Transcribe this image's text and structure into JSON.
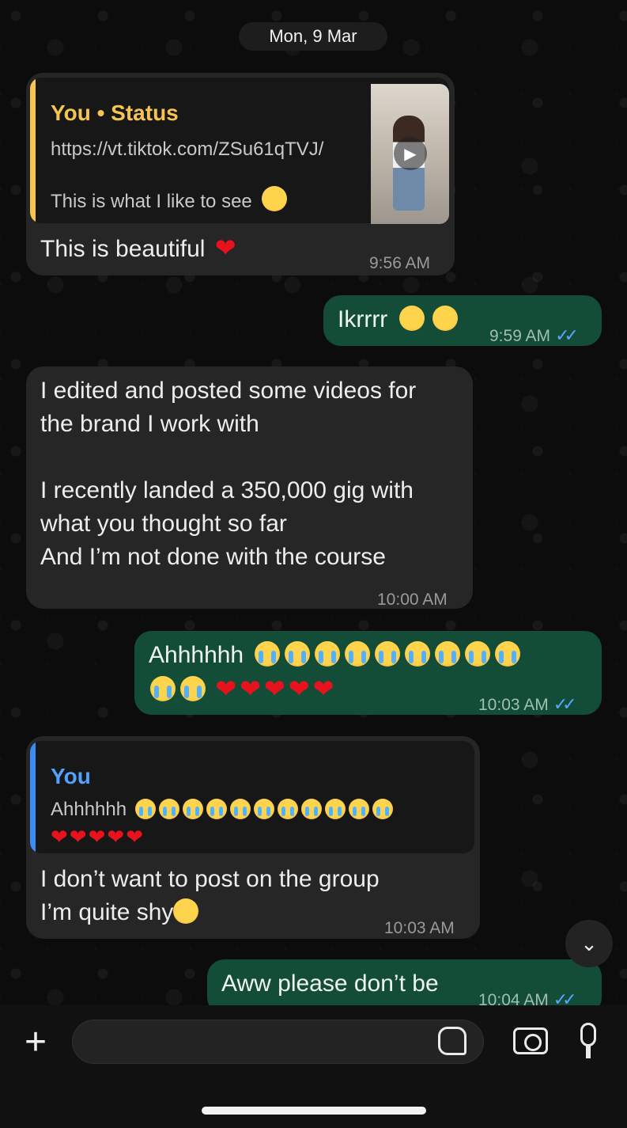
{
  "date_label": "Mon, 9 Mar",
  "messages": [
    {
      "quote_title": "You • Status",
      "quote_link": "https://vt.tiktok.com/ZSu61qTVJ/",
      "quote_caption": "This is what I like to see",
      "text": "This is beautiful",
      "time": "9:56 AM"
    },
    {
      "text": "Ikrrrr",
      "time": "9:59 AM"
    },
    {
      "line1": "I edited and posted some videos for",
      "line2": "the brand I work with",
      "line3": "I recently landed a 350,000 gig with",
      "line4": "what you thought so far",
      "line5": "And I’m not done with the course",
      "time": "10:00 AM"
    },
    {
      "text": "Ahhhhhh",
      "time": "10:03 AM"
    },
    {
      "quote_title": "You",
      "quote_text": "Ahhhhhh",
      "line1": "I don’t want to post on the group",
      "line2": "I’m quite shy",
      "time": "10:03 AM"
    },
    {
      "text": "Aww please don’t be",
      "time": "10:04 AM"
    }
  ],
  "read_ticks": "✓✓",
  "icons": {
    "scroll_down": "chevron-down-icon",
    "attach": "plus-icon",
    "sticker": "sticker-icon",
    "camera": "camera-icon",
    "mic": "microphone-icon"
  },
  "colors": {
    "outgoing_bubble": "#144d37",
    "incoming_bubble": "#262626",
    "status_quote_bar": "#f5c451",
    "reply_quote_bar": "#3d8bf5",
    "read_ticks": "#57a6ff"
  }
}
